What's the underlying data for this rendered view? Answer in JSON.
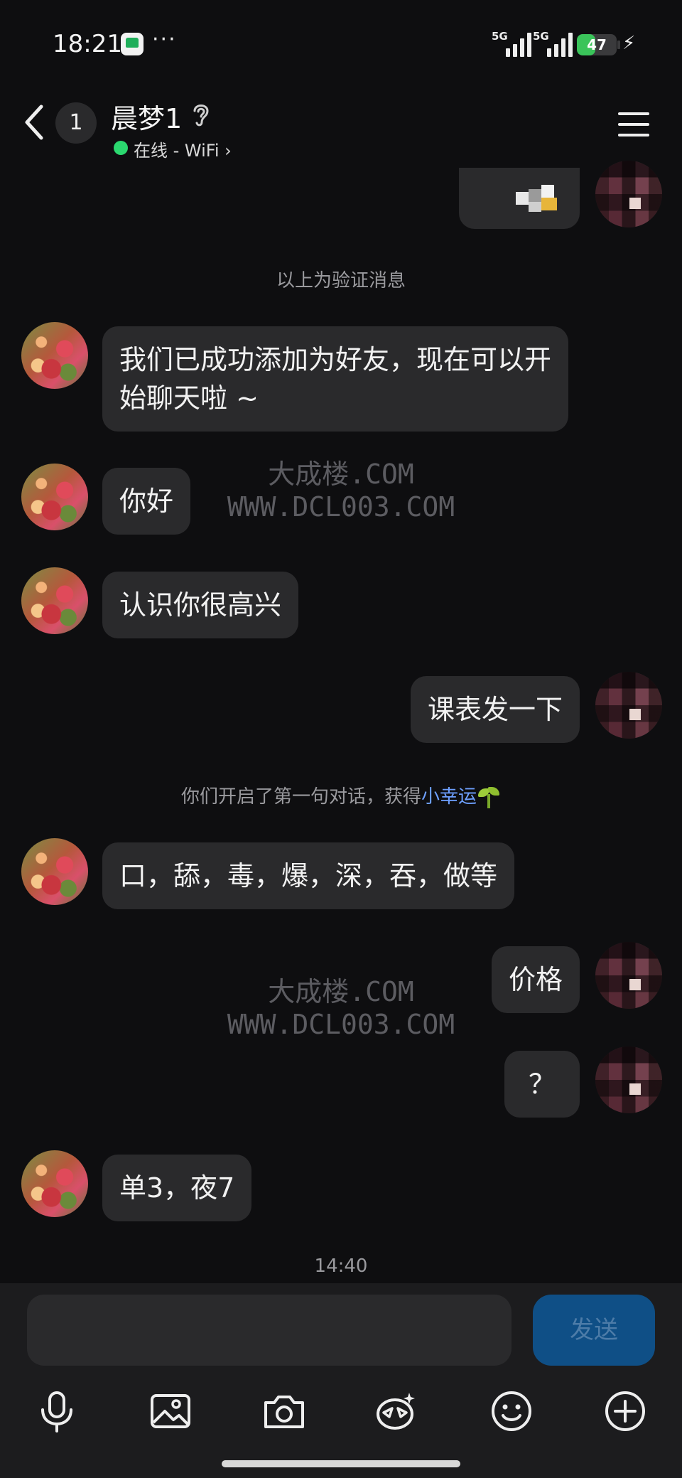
{
  "status_bar": {
    "time": "18:21",
    "more": "···",
    "signal1_label": "5G",
    "signal2_label": "5G",
    "battery": "47",
    "battery_level": 0.47
  },
  "header": {
    "unread_count": "1",
    "contact_name": "晨梦1",
    "status": "在线 - WiFi",
    "status_color": "#2bd86f"
  },
  "chat": {
    "system1": "以上为验证消息",
    "msg1": "我们已成功添加为好友，现在可以开始聊天啦 ~",
    "msg2": "你好",
    "msg3": "认识你很高兴",
    "msg4": "课表发一下",
    "system2_prefix": "你们开启了第一句对话，获得",
    "system2_link": "小幸运",
    "msg5": "口，舔，毒，爆，深，吞，做等",
    "msg6": "价格",
    "msg7": "？",
    "msg8": "单3，夜7",
    "timestamp": "14:40",
    "watermark_line1": "大成楼.COM",
    "watermark_line2": "WWW.DCL003.COM"
  },
  "input": {
    "send_label": "发送",
    "send_color": "#0f4f86"
  },
  "toolbar": {
    "icons": [
      "microphone-icon",
      "image-icon",
      "camera-icon",
      "emoji-red-packet-icon",
      "smiley-icon",
      "plus-icon"
    ]
  }
}
